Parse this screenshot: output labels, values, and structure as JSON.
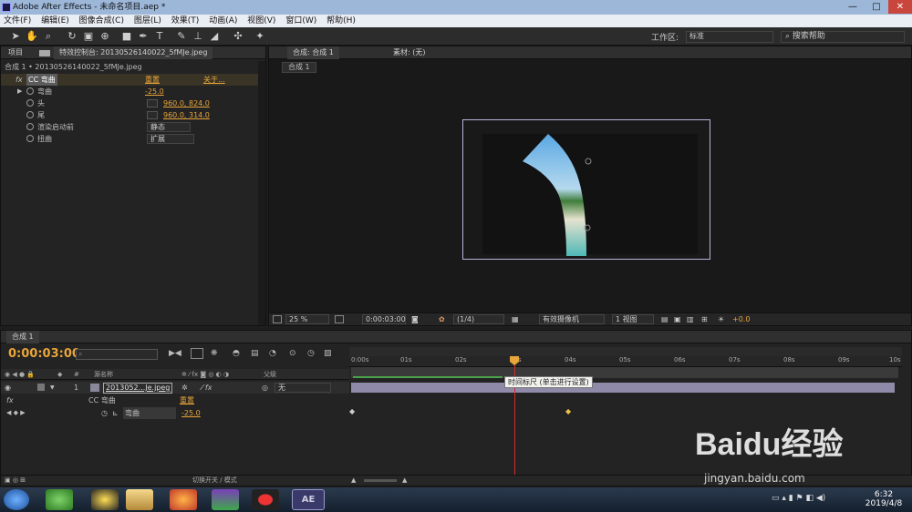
{
  "window": {
    "title": "Adobe After Effects - 未命名项目.aep *",
    "controls": [
      "—",
      "□",
      "✕"
    ]
  },
  "menu": [
    "文件(F)",
    "编辑(E)",
    "图像合成(C)",
    "图层(L)",
    "效果(T)",
    "动画(A)",
    "视图(V)",
    "窗口(W)",
    "帮助(H)"
  ],
  "toolbar": {
    "workspace_label": "工作区:",
    "workspace_value": "标准",
    "search_placeholder": "搜索帮助"
  },
  "left_panel": {
    "tab_project": "项目",
    "tab_effects": "特效控制台: 20130526140022_5fMJe.jpeg",
    "breadcrumb": "合成 1 • 20130526140022_5fMJe.jpeg",
    "effect_name": "CC 弯曲",
    "reset": "重置",
    "about": "关于...",
    "props": [
      {
        "label": "弯曲",
        "value": "-25.0"
      },
      {
        "label": "头",
        "value": "960.0, 824.0"
      },
      {
        "label": "尾",
        "value": "960.0, 314.0"
      },
      {
        "label": "渲染启动前",
        "value": "静态"
      },
      {
        "label": "扭曲",
        "value": "扩展"
      }
    ]
  },
  "viewer": {
    "tab_comp": "合成: 合成 1",
    "tab_footage": "素材: (无)",
    "sub_tab": "合成 1",
    "zoom": "25 %",
    "timecode": "0:00:03:00",
    "resolution": "(1/4)",
    "camera": "有效摄像机",
    "views": "1 视图",
    "exposure": "+0.0"
  },
  "timeline": {
    "tab": "合成 1",
    "time": "0:00:03:00",
    "search_placeholder": "",
    "col_name": "源名称",
    "col_parent": "父级",
    "layer_index": "1",
    "layer_name": "2013052...Je.jpeg",
    "parent_value": "无",
    "effect_row": "CC 弯曲",
    "effect_reset": "重置",
    "prop_name": "弯曲",
    "prop_value": "-25.0",
    "bottom_label": "切换开关 / 模式",
    "ruler": [
      "0:00s",
      "01s",
      "02s",
      "03s",
      "04s",
      "05s",
      "06s",
      "07s",
      "08s",
      "09s",
      "10s"
    ],
    "tooltip": "时间标尺 (单击进行设置)"
  },
  "taskbar": {
    "clock_time": "6:32",
    "clock_date": "2019/4/8"
  },
  "watermark": {
    "brand": "Baidu经验",
    "url": "jingyan.baidu.com"
  },
  "colors": {
    "accent": "#e8a53a",
    "playhead": "#d52a2a",
    "layer_bar": "#8e8aa8",
    "work_area": "#4aa34a"
  }
}
